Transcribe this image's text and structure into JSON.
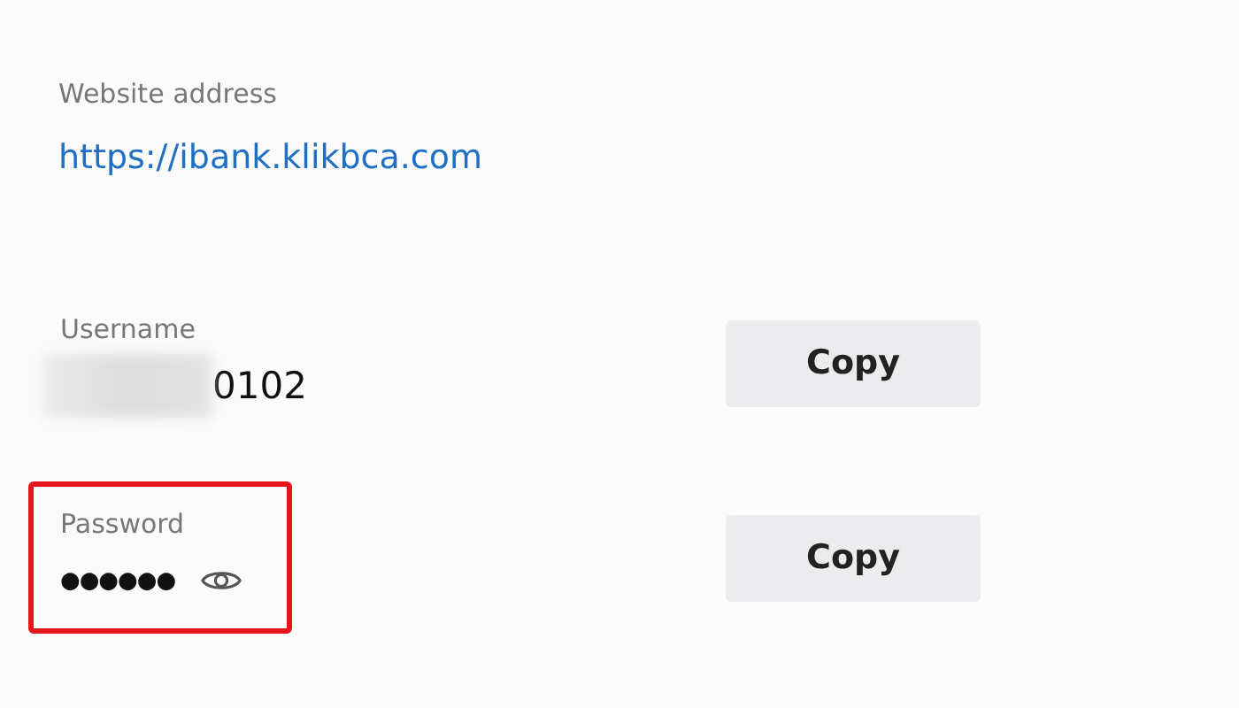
{
  "website": {
    "label": "Website address",
    "link": "https://ibank.klikbca.com"
  },
  "fields": [
    {
      "kind": "username",
      "label": "Username",
      "value": "0102",
      "blurred": true,
      "highlighted": false,
      "button": "Copy"
    },
    {
      "kind": "password",
      "label": "Password",
      "value": "●●●●●●",
      "blurred": false,
      "highlighted": true,
      "button": "Copy"
    }
  ]
}
